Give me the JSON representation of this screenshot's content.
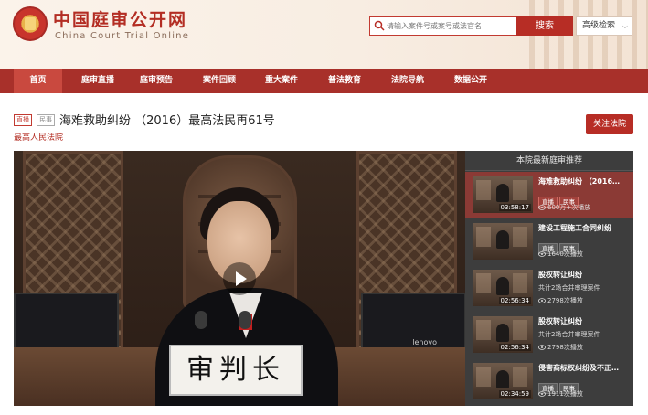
{
  "header": {
    "title": "中国庭审公开网",
    "subtitle": "China Court Trial Online",
    "search_placeholder": "请输入案件号或案号或法官名",
    "search_button": "搜索",
    "advanced_search": "高级检索"
  },
  "nav": {
    "items": [
      "首页",
      "庭审直播",
      "庭审预告",
      "案件回顾",
      "重大案件",
      "普法教育",
      "法院导航",
      "数据公开"
    ],
    "active": "首页"
  },
  "case": {
    "tag_live": "直播",
    "tag_type": "民事",
    "title": "海难救助纠纷 （2016）最高法民再61号",
    "court": "最高人民法院",
    "follow_button": "关注法院"
  },
  "video": {
    "nameplate": "审判长",
    "monitor_brand": "lenovo"
  },
  "sidebar": {
    "title": "本院最新庭审推荐",
    "items": [
      {
        "title": "海难救助纠纷 （2016…",
        "tags": [
          "直播",
          "民事"
        ],
        "subtitle": "",
        "views": "600万+次播放",
        "duration": "03:58:17",
        "active": true
      },
      {
        "title": "建设工程施工合同纠纷",
        "tags": [
          "直播",
          "民事"
        ],
        "subtitle": "",
        "views": "1640次播放",
        "duration": "",
        "active": false
      },
      {
        "title": "股权转让纠纷",
        "tags": [],
        "subtitle": "共计2场合并审理案件",
        "views": "2798次播放",
        "duration": "02:56:34",
        "active": false
      },
      {
        "title": "股权转让纠纷",
        "tags": [],
        "subtitle": "共计2场合并审理案件",
        "views": "2798次播放",
        "duration": "02:56:34",
        "active": false
      },
      {
        "title": "侵害商标权纠纷及不正…",
        "tags": [
          "直播",
          "民事"
        ],
        "subtitle": "",
        "views": "1911次播放",
        "duration": "02:34:59",
        "active": false
      }
    ]
  },
  "colors": {
    "brand_red": "#b72d25",
    "nav_bg": "#a8302a",
    "nav_active": "#c9493f",
    "sidebar_bg": "#3d3d3d",
    "sidebar_active": "#8b3a35"
  }
}
